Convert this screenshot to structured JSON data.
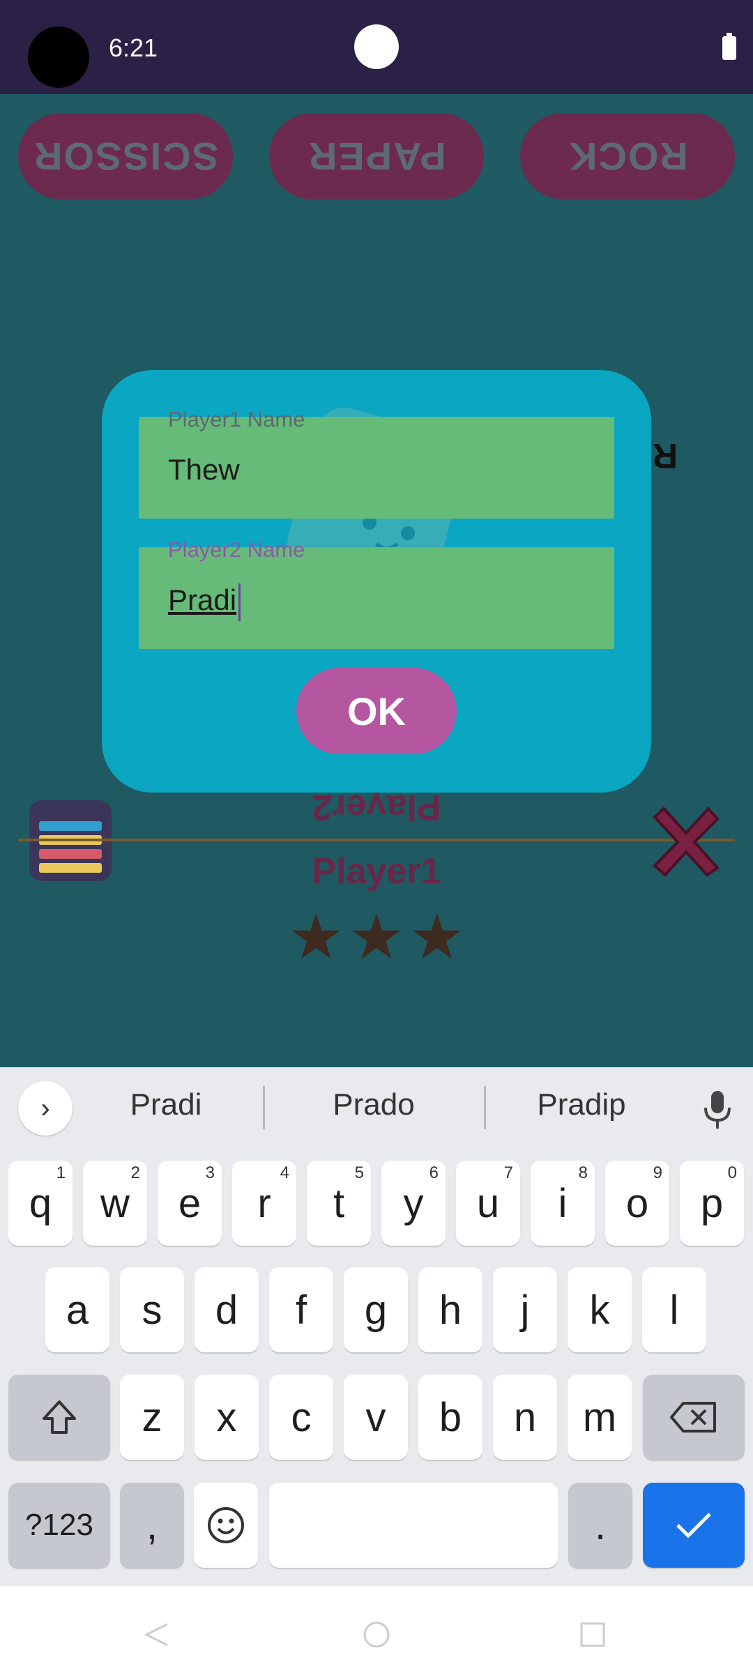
{
  "status_bar": {
    "time": "6:21"
  },
  "game": {
    "top_buttons": [
      "SCISSOR",
      "PAPER",
      "ROCK"
    ],
    "ready_label": "Ready",
    "player2_label": "Player2",
    "player1_label": "Player1",
    "stars": 3
  },
  "dialog": {
    "player1_label": "Player1 Name",
    "player1_value": "Thew",
    "player2_label": "Player2 Name",
    "player2_value": "Pradi",
    "ok_label": "OK"
  },
  "keyboard": {
    "suggestions": [
      "Pradi",
      "Prado",
      "Pradip"
    ],
    "row1": [
      {
        "key": "q",
        "num": "1"
      },
      {
        "key": "w",
        "num": "2"
      },
      {
        "key": "e",
        "num": "3"
      },
      {
        "key": "r",
        "num": "4"
      },
      {
        "key": "t",
        "num": "5"
      },
      {
        "key": "y",
        "num": "6"
      },
      {
        "key": "u",
        "num": "7"
      },
      {
        "key": "i",
        "num": "8"
      },
      {
        "key": "o",
        "num": "9"
      },
      {
        "key": "p",
        "num": "0"
      }
    ],
    "row2": [
      "a",
      "s",
      "d",
      "f",
      "g",
      "h",
      "j",
      "k",
      "l"
    ],
    "row3": [
      "z",
      "x",
      "c",
      "v",
      "b",
      "n",
      "m"
    ],
    "symbols_label": "?123",
    "comma_label": ",",
    "period_label": ".",
    "icons": {
      "shift": "shift-icon",
      "backspace": "backspace-icon",
      "emoji": "emoji-icon",
      "enter": "check-icon",
      "mic": "mic-icon"
    }
  },
  "colors": {
    "accent": "#1a73e8",
    "dialog": "#0aa6c2",
    "field": "#66bb78",
    "ok": "#b556a0"
  }
}
